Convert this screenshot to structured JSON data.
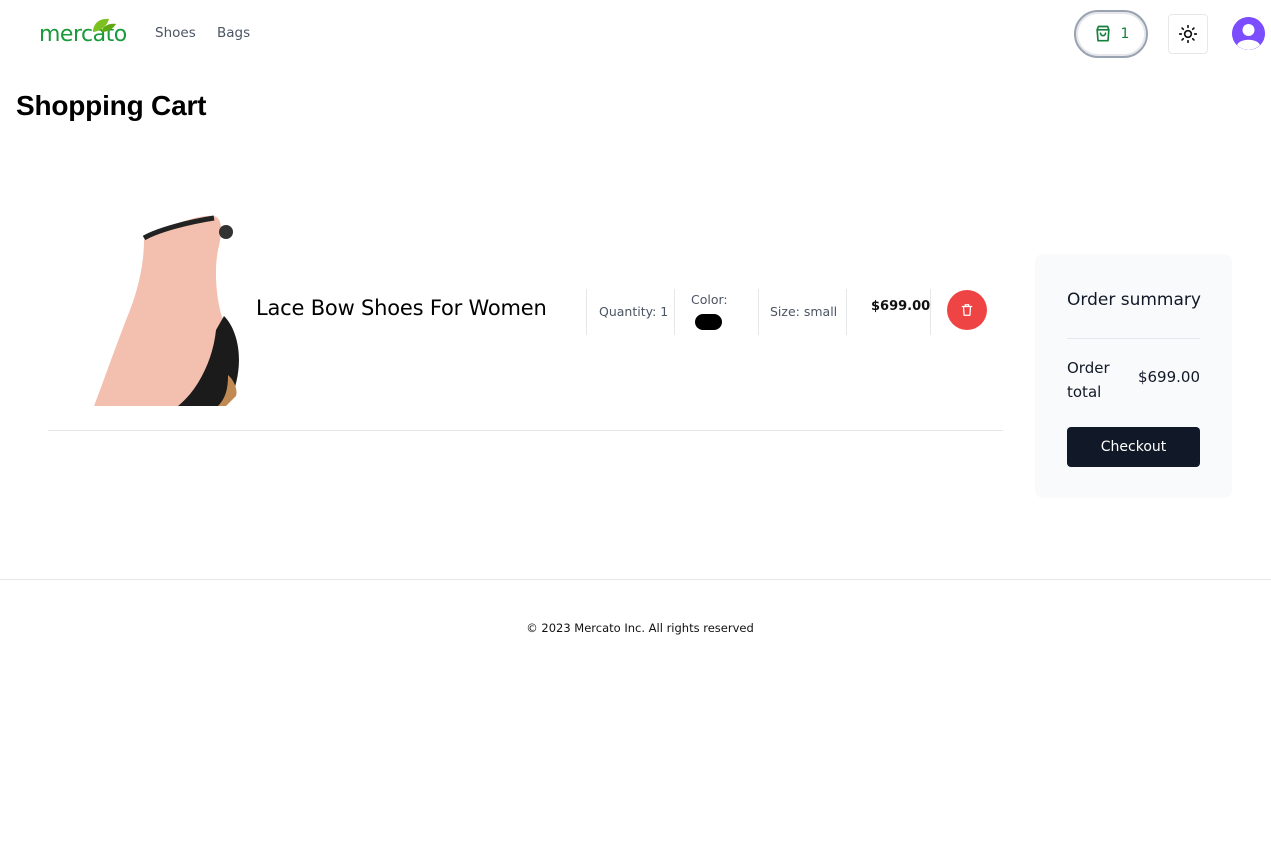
{
  "brand": {
    "name": "mercato",
    "color": "#1a9a3a",
    "leaf_color": "#7cc11f",
    "icon": "leaf-icon"
  },
  "nav": {
    "items": [
      {
        "label": "Shoes"
      },
      {
        "label": "Bags"
      }
    ]
  },
  "header": {
    "cart_count": "1",
    "cart_icon": "shopping-bag-icon",
    "theme_icon": "sun-icon",
    "avatar_icon": "user-avatar-icon",
    "avatar_color": "#7c4dff"
  },
  "page": {
    "title": "Shopping Cart"
  },
  "cart": {
    "items": [
      {
        "name": "Lace Bow Shoes For Women",
        "quantity_label": "Quantity: 1",
        "color_label": "Color:",
        "color_value": "#000000",
        "size_label": "Size: small",
        "price": "$699.00",
        "remove_icon": "trash-icon",
        "remove_color": "#ef4444"
      }
    ]
  },
  "summary": {
    "title": "Order summary",
    "total_label": "Order total",
    "total_value": "$699.00",
    "checkout_label": "Checkout",
    "checkout_color": "#111827"
  },
  "footer": {
    "copyright": "© 2023 Mercato Inc. All rights reserved"
  }
}
